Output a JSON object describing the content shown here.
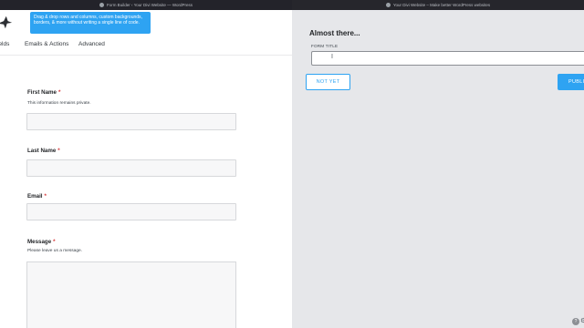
{
  "window_left": {
    "title": "Form Builder ‹ Your Divi Website — WordPress"
  },
  "window_right": {
    "title": "Your Divi Website – Make better WordPress websites"
  },
  "tooltip": {
    "text": "Drag & drop rows and columns, custom backgrounds, borders, & more without writing a single line of code."
  },
  "tabs": [
    {
      "label": "ields"
    },
    {
      "label": "Emails & Actions"
    },
    {
      "label": "Advanced"
    }
  ],
  "fields": [
    {
      "label": "First Name",
      "required_mark": "*",
      "description": "This information remains private."
    },
    {
      "label": "Last Name",
      "required_mark": "*"
    },
    {
      "label": "Email",
      "required_mark": "*"
    },
    {
      "label": "Message",
      "required_mark": "*",
      "description": "Please leave us a message."
    }
  ],
  "publish_panel": {
    "heading": "Almost there...",
    "form_title_label": "FORM TITLE",
    "form_title_value": "",
    "not_yet_label": "NOT YET",
    "publish_label": "PUBLI"
  },
  "colors": {
    "accent": "#2ea3f2",
    "required": "#d63638",
    "right_bg": "#e6e7ea"
  }
}
